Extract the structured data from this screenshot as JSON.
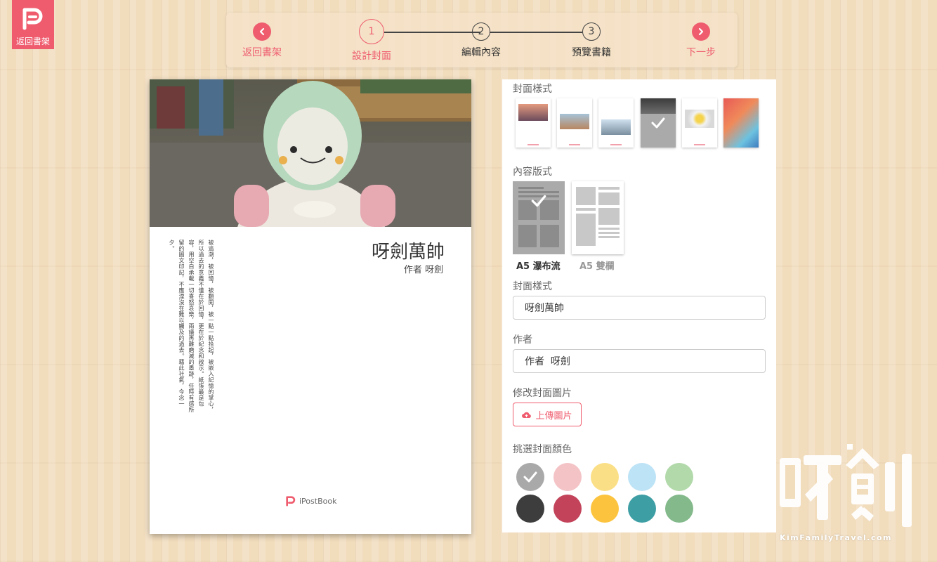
{
  "logo": {
    "label": "返回書架",
    "icon": "ipostbook-logo-icon"
  },
  "stepper": {
    "back": {
      "label": "返回書架",
      "icon": "chevron-left-icon"
    },
    "steps": [
      {
        "number": "1",
        "label": "設計封面",
        "state": "active"
      },
      {
        "number": "2",
        "label": "編輯內容",
        "state": "inactive"
      },
      {
        "number": "3",
        "label": "預覽書籍",
        "state": "inactive"
      }
    ],
    "next": {
      "label": "下一步",
      "icon": "chevron-right-icon"
    },
    "accent": "#ef5c6e"
  },
  "book": {
    "title": "呀劍萬帥",
    "author": "作者  呀劍",
    "body_text": "被追溯，被回憶，被翻閱，被一點一點拾起，被嵌入記憶的掌心，所以過去的意義不僅在於回憶，更在於紀念和啟示。紙張最是包容，用空白承載一切喜怒哀樂，兩議再難磨滅的墨跡，任時有感所留的圖文印記，不應湮沒在難以觸及的過去。藉此社氣，今念一夕。",
    "brand": "iPostBook"
  },
  "panel": {
    "cover_style_label": "封面樣式",
    "cover_styles": [
      {
        "name": "style-1",
        "selected": false
      },
      {
        "name": "style-2",
        "selected": false
      },
      {
        "name": "style-3",
        "selected": false
      },
      {
        "name": "style-4",
        "selected": true
      },
      {
        "name": "style-5",
        "selected": false
      },
      {
        "name": "style-6",
        "selected": false
      }
    ],
    "layout_label": "內容版式",
    "layouts": [
      {
        "label": "A5 瀑布流",
        "selected": true
      },
      {
        "label": "A5 雙欄",
        "selected": false
      }
    ],
    "title_field_label": "封面樣式",
    "title_value": "呀劍萬帥",
    "author_field_label": "作者",
    "author_value": "作者  呀劍",
    "cover_image_label": "修改封面圖片",
    "upload_label": "上傳圖片",
    "upload_icon": "cloud-upload-icon",
    "color_label": "挑選封面顏色",
    "colors": [
      "#a9a9a9",
      "#f4c3c6",
      "#fbdf86",
      "#bde3f6",
      "#b1d9a9",
      "#3d3d3d",
      "#c3445a",
      "#fcc43e",
      "#3d9ea4",
      "#83b98b"
    ],
    "selected_color": "#a9a9a9"
  },
  "watermark": {
    "text": "呀劍",
    "url": "KimFamilyTravel.com"
  }
}
